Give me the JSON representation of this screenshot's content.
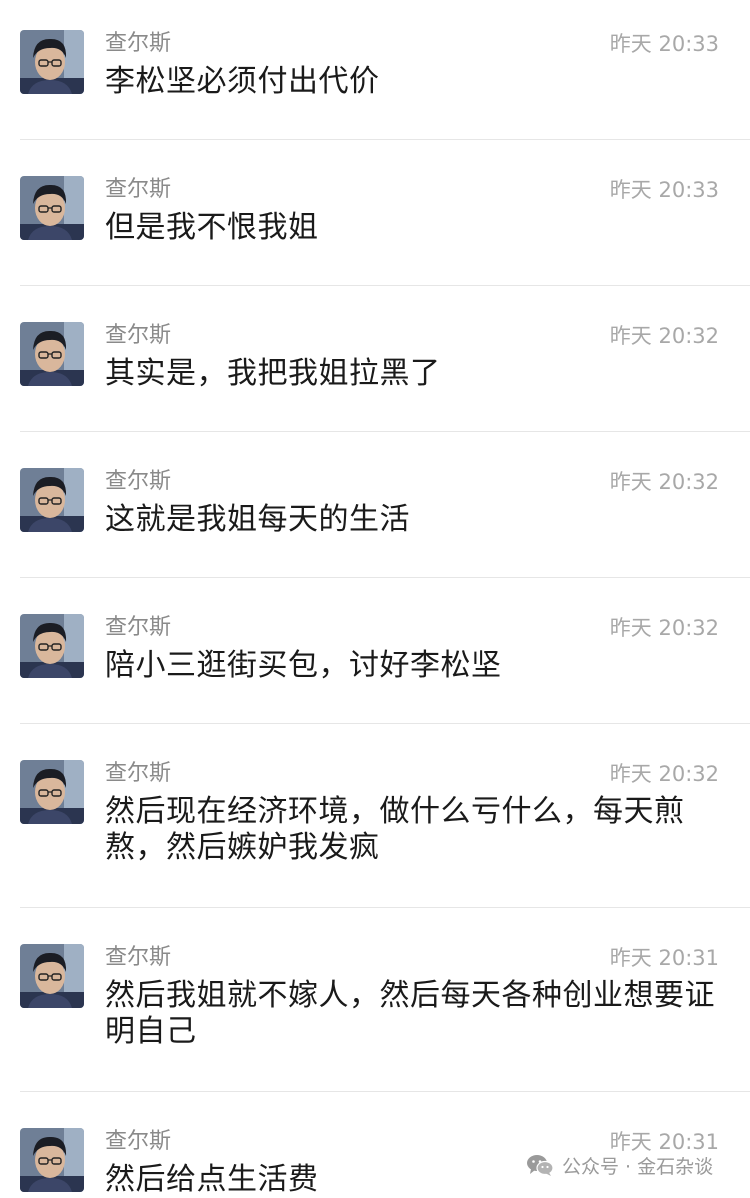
{
  "messages": [
    {
      "name": "查尔斯",
      "time": "昨天 20:33",
      "text": "李松坚必须付出代价"
    },
    {
      "name": "查尔斯",
      "time": "昨天 20:33",
      "text": "但是我不恨我姐"
    },
    {
      "name": "查尔斯",
      "time": "昨天 20:32",
      "text": "其实是，我把我姐拉黑了"
    },
    {
      "name": "查尔斯",
      "time": "昨天 20:32",
      "text": "这就是我姐每天的生活"
    },
    {
      "name": "查尔斯",
      "time": "昨天 20:32",
      "text": "陪小三逛街买包，讨好李松坚"
    },
    {
      "name": "查尔斯",
      "time": "昨天 20:32",
      "text": "然后现在经济环境，做什么亏什么，每天煎熬，然后嫉妒我发疯"
    },
    {
      "name": "查尔斯",
      "time": "昨天 20:31",
      "text": "然后我姐就不嫁人，然后每天各种创业想要证明自己"
    },
    {
      "name": "查尔斯",
      "time": "昨天 20:31",
      "text": "然后给点生活费"
    }
  ],
  "watermark": {
    "icon": "wechat-icon",
    "text": "公众号 · 金石杂谈"
  },
  "colors": {
    "name": "#8a8a8a",
    "time": "#a8a8a8",
    "text": "#1a1a1a",
    "divider": "#e6e6e6"
  }
}
